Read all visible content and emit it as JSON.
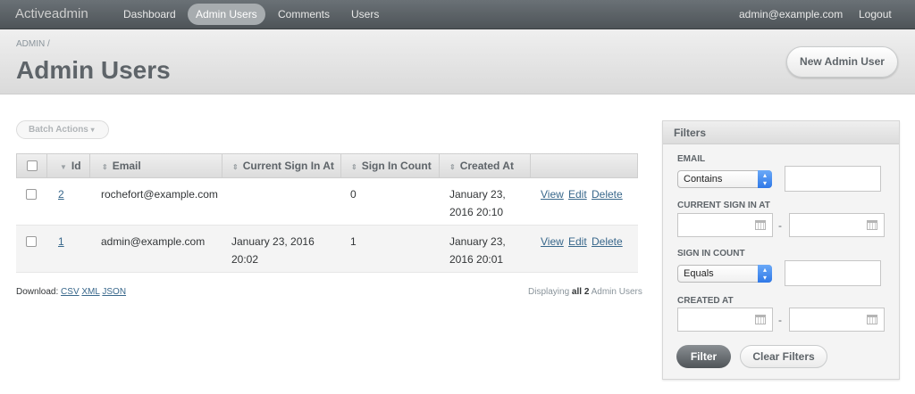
{
  "nav": {
    "brand": "Activeadmin",
    "items": [
      "Dashboard",
      "Admin Users",
      "Comments",
      "Users"
    ],
    "active": "Admin Users",
    "user_email": "admin@example.com",
    "logout": "Logout"
  },
  "header": {
    "breadcrumb": "ADMIN",
    "breadcrumb_sep": "/",
    "title": "Admin Users",
    "new_button": "New Admin User"
  },
  "batch_actions": {
    "label": "Batch Actions",
    "caret": "▾"
  },
  "table": {
    "columns": [
      "Id",
      "Email",
      "Current Sign In At",
      "Sign In Count",
      "Created At"
    ],
    "rows": [
      {
        "id": "2",
        "email": "rochefort@example.com",
        "current_sign_in_line1": "",
        "current_sign_in_line2": "",
        "sign_in_count": "0",
        "created_line1": "January 23,",
        "created_line2": "2016 20:10",
        "view": "View",
        "edit": "Edit",
        "delete": "Delete"
      },
      {
        "id": "1",
        "email": "admin@example.com",
        "current_sign_in_line1": "January 23, 2016",
        "current_sign_in_line2": "20:02",
        "sign_in_count": "1",
        "created_line1": "January 23,",
        "created_line2": "2016 20:01",
        "view": "View",
        "edit": "Edit",
        "delete": "Delete"
      }
    ]
  },
  "download": {
    "label": "Download:",
    "csv": "CSV",
    "xml": "XML",
    "json": "JSON"
  },
  "pagination": {
    "prefix": "Displaying",
    "bold": "all 2",
    "suffix": "Admin Users"
  },
  "filters": {
    "title": "Filters",
    "email_label": "EMAIL",
    "email_select": "Contains",
    "current_sign_in_label": "CURRENT SIGN IN AT",
    "sign_in_count_label": "SIGN IN COUNT",
    "sign_in_count_select": "Equals",
    "created_at_label": "CREATED AT",
    "range_sep": "-",
    "filter_button": "Filter",
    "clear_button": "Clear Filters"
  }
}
